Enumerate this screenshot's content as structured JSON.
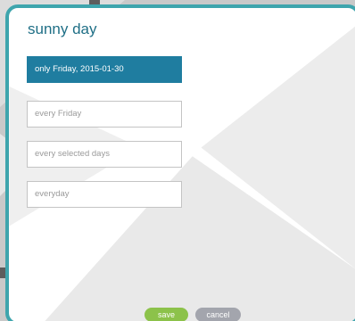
{
  "dialog": {
    "title": "sunny day",
    "options": [
      {
        "label": "only Friday, 2015-01-30",
        "selected": true
      },
      {
        "label": "every Friday",
        "selected": false
      },
      {
        "label": "every selected days",
        "selected": false
      },
      {
        "label": "everyday",
        "selected": false
      }
    ],
    "save_label": "save",
    "cancel_label": "cancel"
  },
  "colors": {
    "border": "#3ea5ad",
    "title": "#1f6f86",
    "selected_bg": "#1f7da0",
    "save_bg": "#8cc24a",
    "cancel_bg": "#a3a5ad"
  }
}
